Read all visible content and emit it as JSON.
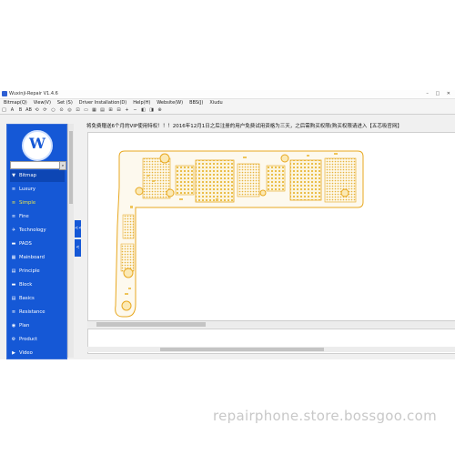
{
  "window": {
    "title": "Wuxinji-Repair V1.4.6",
    "controls": "–  □  ✕"
  },
  "menubar": [
    "Bitmap(Q)",
    "View(V)",
    "Set (S)",
    "Driver Installation(D)",
    "Help(H)",
    "Website(W)",
    "BBS(J)",
    "Xiudu"
  ],
  "toolbar": [
    "□",
    "A",
    "B",
    "AB",
    "⟲",
    "⟳",
    "○",
    "⊙",
    "◎",
    "⊡",
    "▭",
    "▦",
    "▤",
    "⊞",
    "⊟",
    "+",
    "−",
    "◧",
    "◨",
    "⊕"
  ],
  "sidebar": {
    "logo_letter": "W",
    "search_placeholder": "",
    "search_button": "⌕",
    "items": [
      {
        "label": "Bitmap",
        "icon": "▼",
        "active": true
      },
      {
        "label": "Luxury",
        "icon": "≡"
      },
      {
        "label": "Simple",
        "icon": "≡",
        "highlight": true
      },
      {
        "label": "Fine",
        "icon": "≡"
      },
      {
        "label": "Technology",
        "icon": "✈"
      },
      {
        "label": "PADS",
        "icon": "▬"
      },
      {
        "label": "Mainboard",
        "icon": "▦"
      },
      {
        "label": "Principle",
        "icon": "▤"
      },
      {
        "label": "Block",
        "icon": "▬"
      },
      {
        "label": "Basics",
        "icon": "▤"
      },
      {
        "label": "Resistance",
        "icon": "≡"
      },
      {
        "label": "Plan",
        "icon": "◉"
      },
      {
        "label": "Product",
        "icon": "⚙"
      },
      {
        "label": "Video",
        "icon": "▶"
      }
    ]
  },
  "collapse_buttons": [
    "<<",
    "<"
  ],
  "notice": "将免费赠送6个月的VIP使用特权！！！2016年12月1日之后注册的用户免费试用资格为三天，之后需购买权限(购买权限请进入【五芯吸官网】",
  "watermark": "repairphone.store.bossgoo.com",
  "colors": {
    "sidebar": "#1558d6",
    "board_trace": "#e8a820",
    "board_fill": "#fbf4dd"
  }
}
